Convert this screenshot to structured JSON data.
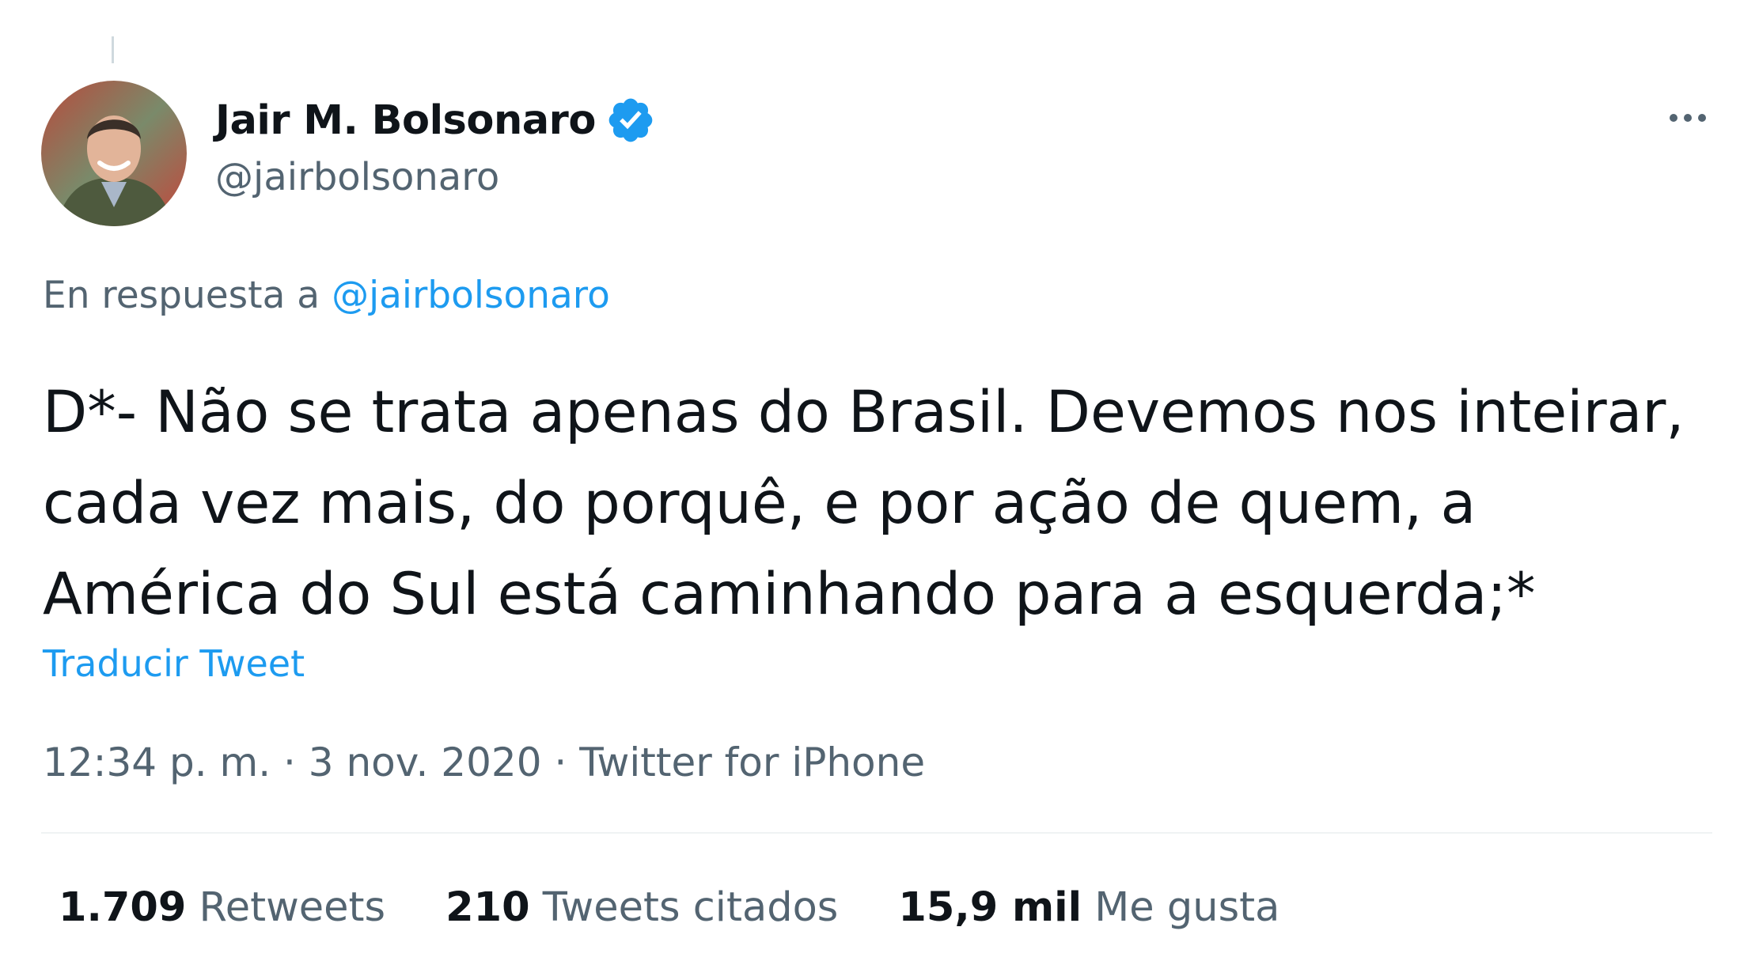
{
  "tweet": {
    "author": {
      "name": "Jair M. Bolsonaro",
      "handle": "@jairbolsonaro",
      "verified": true,
      "avatar_icon": "profile-photo"
    },
    "more_icon": "more-dots-icon",
    "reply_context": {
      "prefix": "En respuesta a ",
      "handle": "@jairbolsonaro"
    },
    "text": "D*- Não se trata apenas do Brasil. Devemos nos inteirar,\ncada vez mais, do porquê, e por ação de quem, a\nAmérica do Sul está caminhando para a esquerda;*",
    "translate_label": "Traducir Tweet",
    "meta": "12:34 p. m. · 3 nov. 2020 · Twitter for iPhone",
    "stats": [
      {
        "count": "1.709",
        "label": "Retweets"
      },
      {
        "count": "210",
        "label": "Tweets citados"
      },
      {
        "count": "15,9 mil",
        "label": "Me gusta"
      }
    ]
  },
  "colors": {
    "accent": "#1d9bf0",
    "secondary_text": "#536471",
    "primary_text": "#0f1419"
  }
}
